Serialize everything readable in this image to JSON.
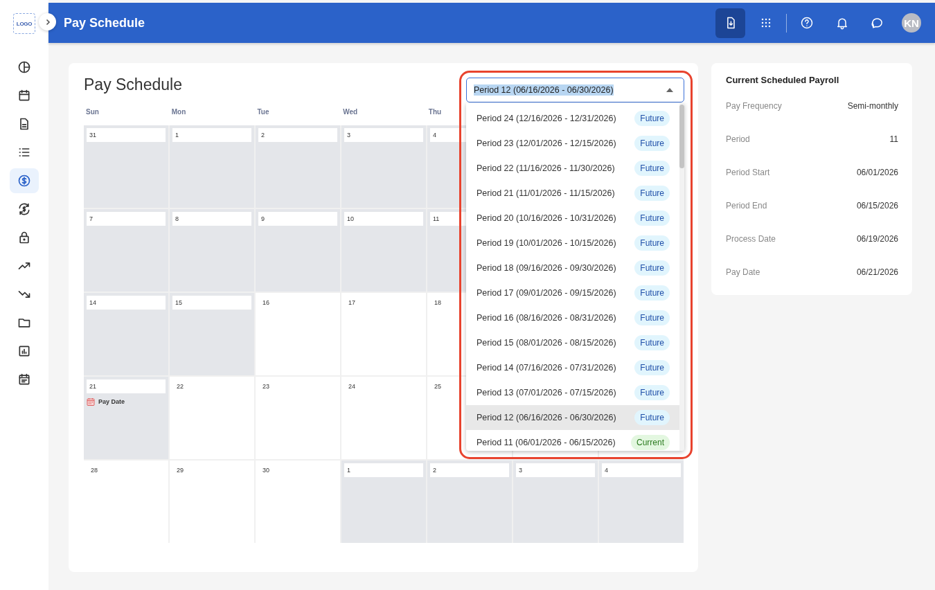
{
  "sidebar": {
    "logo": "LOGO",
    "items": [
      {
        "selected": false
      },
      {
        "selected": false
      },
      {
        "selected": false
      },
      {
        "selected": false
      },
      {
        "selected": true
      },
      {
        "selected": false
      },
      {
        "selected": false
      },
      {
        "selected": false
      },
      {
        "selected": false
      },
      {
        "selected": false
      },
      {
        "selected": false
      },
      {
        "selected": false
      }
    ]
  },
  "header": {
    "title": "Pay Schedule",
    "tools": [
      {
        "active": true
      },
      {
        "active": false
      },
      {
        "active": false
      },
      {
        "active": false
      },
      {
        "active": false
      }
    ],
    "avatar": "KN"
  },
  "calendar": {
    "title": "Pay Schedule",
    "weekdays": [
      "Sun",
      "Mon",
      "Tue",
      "Wed",
      "Thu"
    ],
    "weeks": [
      [
        {
          "day": "31",
          "shaded": true
        },
        {
          "day": "1",
          "shaded": true
        },
        {
          "day": "2",
          "shaded": true
        },
        {
          "day": "3",
          "shaded": true
        },
        {
          "day": "4",
          "shaded": true
        }
      ],
      [
        {
          "day": "7",
          "shaded": true
        },
        {
          "day": "8",
          "shaded": true
        },
        {
          "day": "9",
          "shaded": true
        },
        {
          "day": "10",
          "shaded": true
        },
        {
          "day": "11",
          "shaded": true
        }
      ],
      [
        {
          "day": "14",
          "shaded": true
        },
        {
          "day": "15",
          "shaded": true
        },
        {
          "day": "16",
          "shaded": false
        },
        {
          "day": "17",
          "shaded": false
        },
        {
          "day": "18",
          "shaded": false
        }
      ],
      [
        {
          "day": "21",
          "shaded": true,
          "event": "Pay Date"
        },
        {
          "day": "22",
          "shaded": false
        },
        {
          "day": "23",
          "shaded": false
        },
        {
          "day": "24",
          "shaded": false
        },
        {
          "day": "25",
          "shaded": false
        }
      ],
      [
        {
          "day": "28",
          "shaded": false
        },
        {
          "day": "29",
          "shaded": false
        },
        {
          "day": "30",
          "shaded": false
        },
        {
          "day": "1",
          "shaded": true
        },
        {
          "day": "2",
          "shaded": true
        },
        {
          "day": "3",
          "shaded": true
        },
        {
          "day": "4",
          "shaded": true
        }
      ]
    ]
  },
  "period_select": {
    "value": "Period 12 (06/16/2026 - 06/30/2026)",
    "expanded": true,
    "options": [
      {
        "label": "Period 24 (12/16/2026 - 12/31/2026)",
        "status": "Future",
        "kind": "future",
        "selected": false
      },
      {
        "label": "Period 23 (12/01/2026 - 12/15/2026)",
        "status": "Future",
        "kind": "future",
        "selected": false
      },
      {
        "label": "Period 22 (11/16/2026 - 11/30/2026)",
        "status": "Future",
        "kind": "future",
        "selected": false
      },
      {
        "label": "Period 21 (11/01/2026 - 11/15/2026)",
        "status": "Future",
        "kind": "future",
        "selected": false
      },
      {
        "label": "Period 20 (10/16/2026 - 10/31/2026)",
        "status": "Future",
        "kind": "future",
        "selected": false
      },
      {
        "label": "Period 19 (10/01/2026 - 10/15/2026)",
        "status": "Future",
        "kind": "future",
        "selected": false
      },
      {
        "label": "Period 18 (09/16/2026 - 09/30/2026)",
        "status": "Future",
        "kind": "future",
        "selected": false
      },
      {
        "label": "Period 17 (09/01/2026 - 09/15/2026)",
        "status": "Future",
        "kind": "future",
        "selected": false
      },
      {
        "label": "Period 16 (08/16/2026 - 08/31/2026)",
        "status": "Future",
        "kind": "future",
        "selected": false
      },
      {
        "label": "Period 15 (08/01/2026 - 08/15/2026)",
        "status": "Future",
        "kind": "future",
        "selected": false
      },
      {
        "label": "Period 14 (07/16/2026 - 07/31/2026)",
        "status": "Future",
        "kind": "future",
        "selected": false
      },
      {
        "label": "Period 13 (07/01/2026 - 07/15/2026)",
        "status": "Future",
        "kind": "future",
        "selected": false
      },
      {
        "label": "Period 12 (06/16/2026 - 06/30/2026)",
        "status": "Future",
        "kind": "future",
        "selected": true
      },
      {
        "label": "Period 11 (06/01/2026 - 06/15/2026)",
        "status": "Current",
        "kind": "current",
        "selected": false
      }
    ]
  },
  "summary": {
    "title": "Current Scheduled Payroll",
    "rows": [
      {
        "label": "Pay Frequency",
        "value": "Semi-monthly"
      },
      {
        "label": "Period",
        "value": "11"
      },
      {
        "label": "Period Start",
        "value": "06/01/2026"
      },
      {
        "label": "Period End",
        "value": "06/15/2026"
      },
      {
        "label": "Process Date",
        "value": "06/19/2026"
      },
      {
        "label": "Pay Date",
        "value": "06/21/2026"
      }
    ]
  }
}
